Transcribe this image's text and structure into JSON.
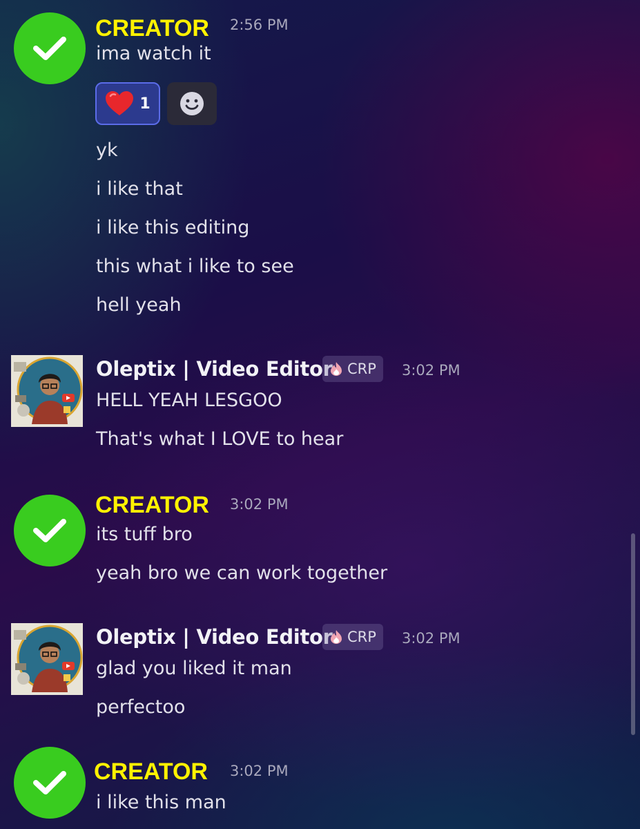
{
  "messages": [
    {
      "author": "CREATOR",
      "time": "2:56 PM",
      "lines": [
        "ima watch it",
        "yk",
        "i like that",
        "i like this editing",
        "this what i like to see",
        "hell yeah"
      ],
      "reaction": {
        "emoji": "heart-icon",
        "count": "1"
      }
    },
    {
      "author": "Oleptix | Video Editor",
      "tag": "CRP",
      "time": "3:02 PM",
      "lines": [
        "HELL YEAH LESGOO",
        "That's what I LOVE to hear"
      ]
    },
    {
      "author": "CREATOR",
      "time": "3:02 PM",
      "lines": [
        "its tuff bro",
        "yeah bro we can work together"
      ]
    },
    {
      "author": "Oleptix | Video Editor",
      "tag": "CRP",
      "time": "3:02 PM",
      "lines": [
        "glad you liked it man",
        "perfectoo"
      ]
    },
    {
      "author": "CREATOR",
      "time": "3:02 PM",
      "lines": [
        "i like this man"
      ]
    }
  ],
  "colors": {
    "creator_name": "#fff200",
    "check_avatar": "#39cc1f",
    "reaction_bg": "#2c3a8e",
    "reaction_border": "#5b6ce8"
  }
}
